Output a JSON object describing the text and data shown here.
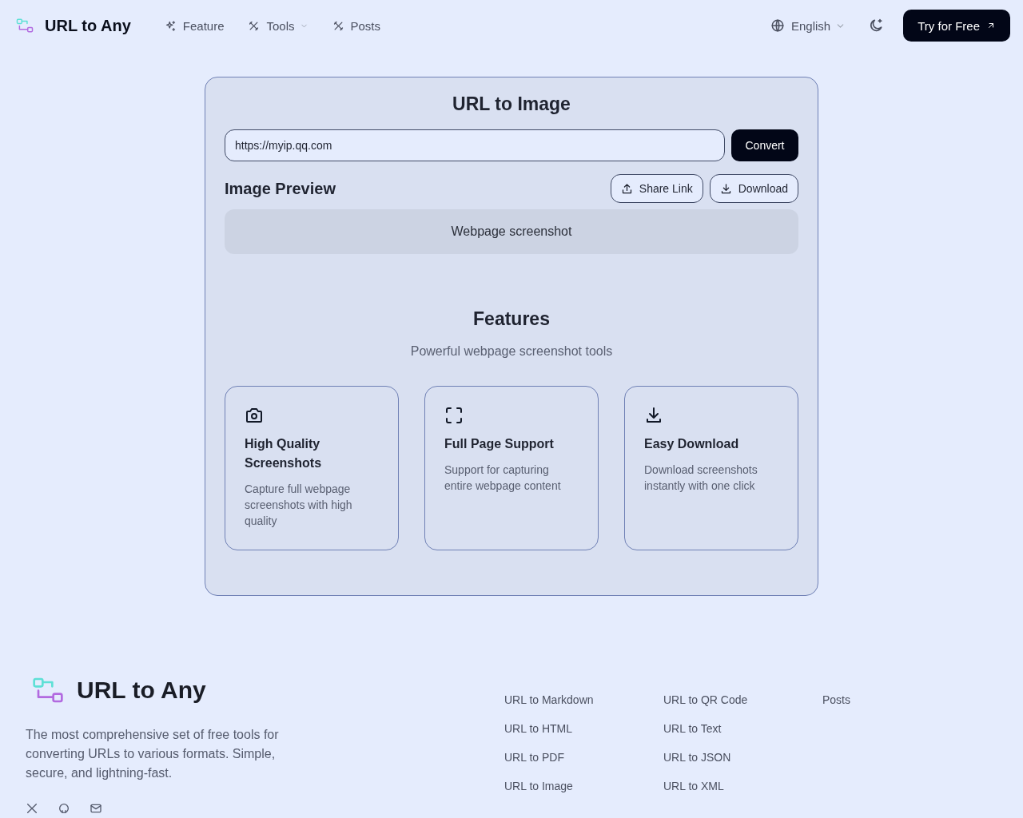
{
  "header": {
    "brand": "URL to Any",
    "nav": [
      {
        "label": "Feature",
        "kind": "sparkle",
        "has_menu": false
      },
      {
        "label": "Tools",
        "kind": "tools",
        "has_menu": true
      },
      {
        "label": "Posts",
        "kind": "tools",
        "has_menu": false
      }
    ],
    "language": "English",
    "cta": "Try for Free"
  },
  "converter": {
    "title": "URL to Image",
    "url_value": "https://myip.qq.com",
    "convert_button": "Convert",
    "preview_title": "Image Preview",
    "share_button": "Share Link",
    "download_button": "Download",
    "preview_placeholder": "Webpage screenshot"
  },
  "features": {
    "title": "Features",
    "subtitle": "Powerful webpage screenshot tools",
    "cards": [
      {
        "kind": "camera",
        "title": "High Quality Screenshots",
        "description": "Capture full webpage screenshots with high quality"
      },
      {
        "kind": "frame",
        "title": "Full Page Support",
        "description": "Support for capturing entire webpage content"
      },
      {
        "kind": "download",
        "title": "Easy Download",
        "description": "Download screenshots instantly with one click"
      }
    ]
  },
  "footer": {
    "brand": "URL to Any",
    "tagline": "The most comprehensive set of free tools for converting URLs to various formats. Simple, secure, and lightning-fast.",
    "columns": [
      [
        "URL to Markdown",
        "URL to HTML",
        "URL to PDF",
        "URL to Image"
      ],
      [
        "URL to QR Code",
        "URL to Text",
        "URL to JSON",
        "URL to XML"
      ],
      [
        "Posts"
      ]
    ]
  }
}
